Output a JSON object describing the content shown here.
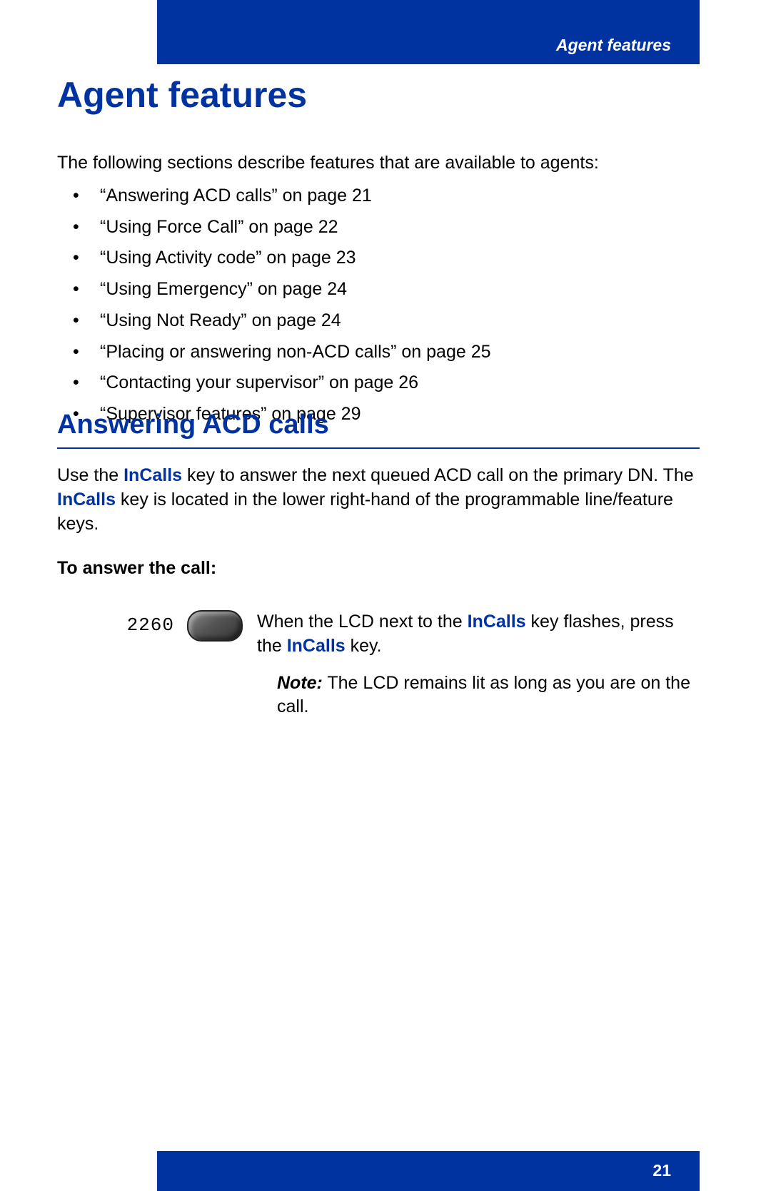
{
  "header": {
    "running_title": "Agent features"
  },
  "title": "Agent features",
  "intro": "The following sections describe features that are available to agents:",
  "toc": [
    "“Answering ACD calls” on page 21",
    "“Using Force Call” on page 22",
    "“Using Activity code” on page 23",
    "“Using Emergency” on page 24",
    "“Using Not Ready” on page 24",
    "“Placing or answering non-ACD calls” on page 25",
    "“Contacting your supervisor” on page 26",
    "“Supervisor features” on page 29"
  ],
  "section": {
    "heading": "Answering ACD calls",
    "p1a": "Use the ",
    "kw1": "InCalls",
    "p1b": " key to answer the next queued ACD call on the primary DN. The ",
    "kw2": "InCalls",
    "p1c": " key is located in the lower right-hand of the programmable line/feature keys.",
    "subhead": "To answer the call:",
    "key_digits": "2260",
    "step_a": "When the LCD next to the ",
    "step_kw1": "InCalls",
    "step_b": " key flashes, press the ",
    "step_kw2": "InCalls",
    "step_c": " key.",
    "note_label": "Note:",
    "note_text": " The LCD remains lit as long as you are on the call."
  },
  "footer": {
    "page_number": "21"
  }
}
